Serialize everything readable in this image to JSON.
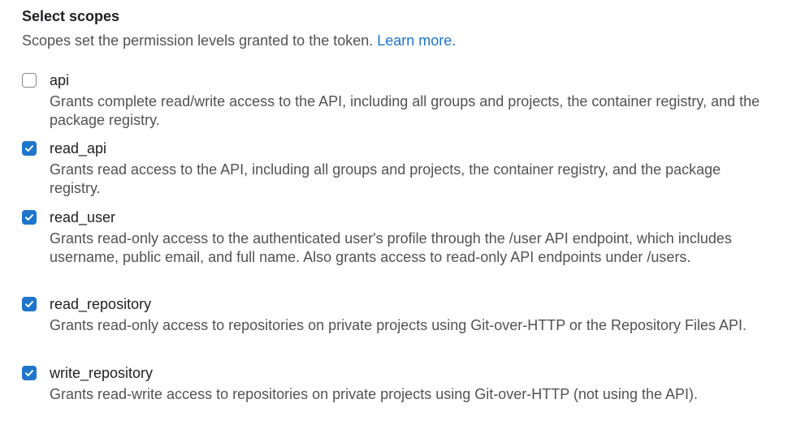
{
  "section": {
    "title": "Select scopes",
    "description": "Scopes set the permission levels granted to the token.",
    "learn_more": "Learn more."
  },
  "scopes": [
    {
      "name": "api",
      "checked": false,
      "description": "Grants complete read/write access to the API, including all groups and projects, the container registry, and the package registry."
    },
    {
      "name": "read_api",
      "checked": true,
      "description": "Grants read access to the API, including all groups and projects, the container registry, and the package registry."
    },
    {
      "name": "read_user",
      "checked": true,
      "description": "Grants read-only access to the authenticated user's profile through the /user API endpoint, which includes username, public email, and full name. Also grants access to read-only API endpoints under /users."
    },
    {
      "name": "read_repository",
      "checked": true,
      "description": "Grants read-only access to repositories on private projects using Git-over-HTTP or the Repository Files API."
    },
    {
      "name": "write_repository",
      "checked": true,
      "description": "Grants read-write access to repositories on private projects using Git-over-HTTP (not using the API)."
    }
  ],
  "colors": {
    "accent": "#1f75cb",
    "text": "#1f1e24",
    "muted": "#535158"
  }
}
